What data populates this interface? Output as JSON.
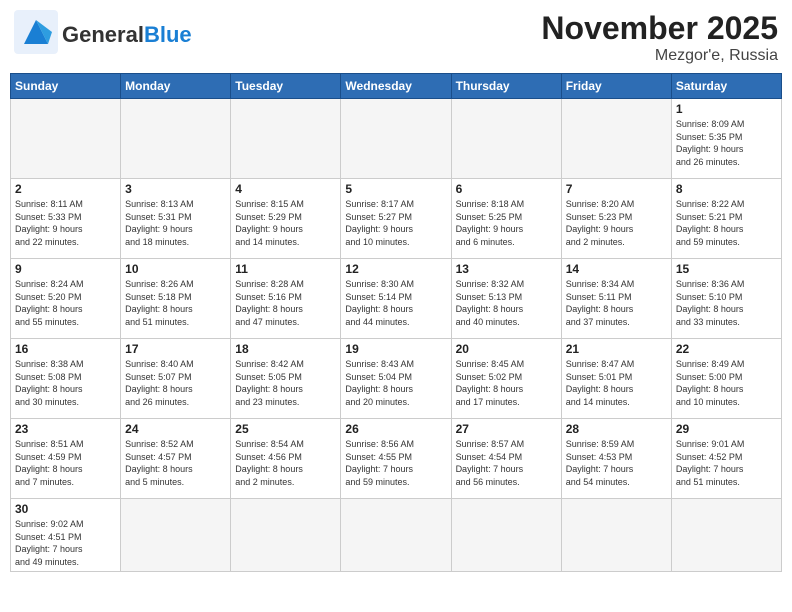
{
  "header": {
    "logo_general": "General",
    "logo_blue": "Blue",
    "title": "November 2025",
    "subtitle": "Mezgor'e, Russia"
  },
  "days_of_week": [
    "Sunday",
    "Monday",
    "Tuesday",
    "Wednesday",
    "Thursday",
    "Friday",
    "Saturday"
  ],
  "weeks": [
    [
      {
        "day": "",
        "info": ""
      },
      {
        "day": "",
        "info": ""
      },
      {
        "day": "",
        "info": ""
      },
      {
        "day": "",
        "info": ""
      },
      {
        "day": "",
        "info": ""
      },
      {
        "day": "",
        "info": ""
      },
      {
        "day": "1",
        "info": "Sunrise: 8:09 AM\nSunset: 5:35 PM\nDaylight: 9 hours\nand 26 minutes."
      }
    ],
    [
      {
        "day": "2",
        "info": "Sunrise: 8:11 AM\nSunset: 5:33 PM\nDaylight: 9 hours\nand 22 minutes."
      },
      {
        "day": "3",
        "info": "Sunrise: 8:13 AM\nSunset: 5:31 PM\nDaylight: 9 hours\nand 18 minutes."
      },
      {
        "day": "4",
        "info": "Sunrise: 8:15 AM\nSunset: 5:29 PM\nDaylight: 9 hours\nand 14 minutes."
      },
      {
        "day": "5",
        "info": "Sunrise: 8:17 AM\nSunset: 5:27 PM\nDaylight: 9 hours\nand 10 minutes."
      },
      {
        "day": "6",
        "info": "Sunrise: 8:18 AM\nSunset: 5:25 PM\nDaylight: 9 hours\nand 6 minutes."
      },
      {
        "day": "7",
        "info": "Sunrise: 8:20 AM\nSunset: 5:23 PM\nDaylight: 9 hours\nand 2 minutes."
      },
      {
        "day": "8",
        "info": "Sunrise: 8:22 AM\nSunset: 5:21 PM\nDaylight: 8 hours\nand 59 minutes."
      }
    ],
    [
      {
        "day": "9",
        "info": "Sunrise: 8:24 AM\nSunset: 5:20 PM\nDaylight: 8 hours\nand 55 minutes."
      },
      {
        "day": "10",
        "info": "Sunrise: 8:26 AM\nSunset: 5:18 PM\nDaylight: 8 hours\nand 51 minutes."
      },
      {
        "day": "11",
        "info": "Sunrise: 8:28 AM\nSunset: 5:16 PM\nDaylight: 8 hours\nand 47 minutes."
      },
      {
        "day": "12",
        "info": "Sunrise: 8:30 AM\nSunset: 5:14 PM\nDaylight: 8 hours\nand 44 minutes."
      },
      {
        "day": "13",
        "info": "Sunrise: 8:32 AM\nSunset: 5:13 PM\nDaylight: 8 hours\nand 40 minutes."
      },
      {
        "day": "14",
        "info": "Sunrise: 8:34 AM\nSunset: 5:11 PM\nDaylight: 8 hours\nand 37 minutes."
      },
      {
        "day": "15",
        "info": "Sunrise: 8:36 AM\nSunset: 5:10 PM\nDaylight: 8 hours\nand 33 minutes."
      }
    ],
    [
      {
        "day": "16",
        "info": "Sunrise: 8:38 AM\nSunset: 5:08 PM\nDaylight: 8 hours\nand 30 minutes."
      },
      {
        "day": "17",
        "info": "Sunrise: 8:40 AM\nSunset: 5:07 PM\nDaylight: 8 hours\nand 26 minutes."
      },
      {
        "day": "18",
        "info": "Sunrise: 8:42 AM\nSunset: 5:05 PM\nDaylight: 8 hours\nand 23 minutes."
      },
      {
        "day": "19",
        "info": "Sunrise: 8:43 AM\nSunset: 5:04 PM\nDaylight: 8 hours\nand 20 minutes."
      },
      {
        "day": "20",
        "info": "Sunrise: 8:45 AM\nSunset: 5:02 PM\nDaylight: 8 hours\nand 17 minutes."
      },
      {
        "day": "21",
        "info": "Sunrise: 8:47 AM\nSunset: 5:01 PM\nDaylight: 8 hours\nand 14 minutes."
      },
      {
        "day": "22",
        "info": "Sunrise: 8:49 AM\nSunset: 5:00 PM\nDaylight: 8 hours\nand 10 minutes."
      }
    ],
    [
      {
        "day": "23",
        "info": "Sunrise: 8:51 AM\nSunset: 4:59 PM\nDaylight: 8 hours\nand 7 minutes."
      },
      {
        "day": "24",
        "info": "Sunrise: 8:52 AM\nSunset: 4:57 PM\nDaylight: 8 hours\nand 5 minutes."
      },
      {
        "day": "25",
        "info": "Sunrise: 8:54 AM\nSunset: 4:56 PM\nDaylight: 8 hours\nand 2 minutes."
      },
      {
        "day": "26",
        "info": "Sunrise: 8:56 AM\nSunset: 4:55 PM\nDaylight: 7 hours\nand 59 minutes."
      },
      {
        "day": "27",
        "info": "Sunrise: 8:57 AM\nSunset: 4:54 PM\nDaylight: 7 hours\nand 56 minutes."
      },
      {
        "day": "28",
        "info": "Sunrise: 8:59 AM\nSunset: 4:53 PM\nDaylight: 7 hours\nand 54 minutes."
      },
      {
        "day": "29",
        "info": "Sunrise: 9:01 AM\nSunset: 4:52 PM\nDaylight: 7 hours\nand 51 minutes."
      }
    ],
    [
      {
        "day": "30",
        "info": "Sunrise: 9:02 AM\nSunset: 4:51 PM\nDaylight: 7 hours\nand 49 minutes."
      },
      {
        "day": "",
        "info": ""
      },
      {
        "day": "",
        "info": ""
      },
      {
        "day": "",
        "info": ""
      },
      {
        "day": "",
        "info": ""
      },
      {
        "day": "",
        "info": ""
      },
      {
        "day": "",
        "info": ""
      }
    ]
  ]
}
